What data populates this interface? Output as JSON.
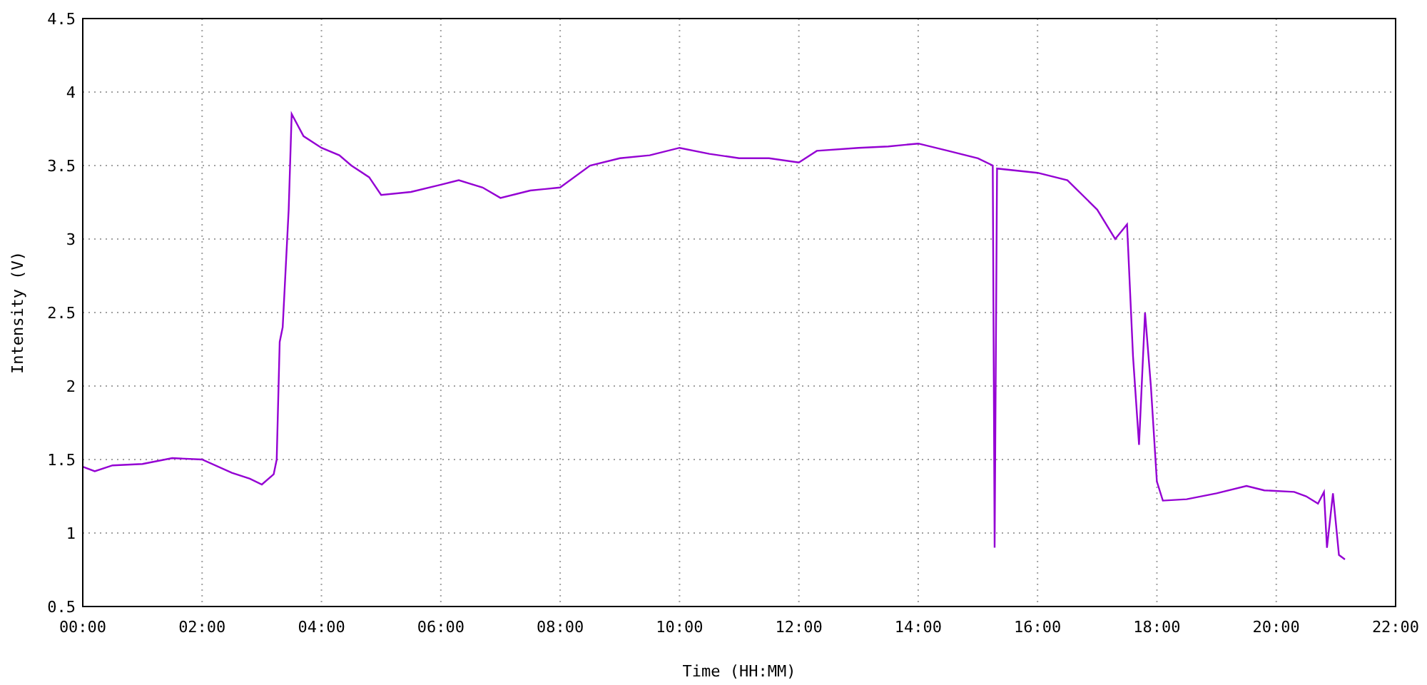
{
  "chart_data": {
    "type": "line",
    "xlabel": "Time (HH:MM)",
    "ylabel": "Intensity (V)",
    "x": [
      0,
      0.2,
      0.5,
      1.0,
      1.5,
      2.0,
      2.5,
      2.8,
      3.0,
      3.2,
      3.25,
      3.3,
      3.35,
      3.45,
      3.5,
      3.7,
      4.0,
      4.3,
      4.5,
      4.8,
      5.0,
      5.5,
      6.0,
      6.3,
      6.7,
      7.0,
      7.5,
      8.0,
      8.5,
      9.0,
      9.5,
      10.0,
      10.5,
      11.0,
      11.5,
      12.0,
      12.3,
      13.0,
      13.5,
      14.0,
      14.5,
      15.0,
      15.25,
      15.28,
      15.32,
      16.0,
      16.5,
      17.0,
      17.3,
      17.5,
      17.6,
      17.7,
      17.8,
      17.9,
      18.0,
      18.1,
      18.5,
      19.0,
      19.5,
      19.8,
      20.3,
      20.5,
      20.7,
      20.8,
      20.85,
      20.95,
      21.05,
      21.15
    ],
    "series": [
      {
        "color": "#9400d3",
        "values": [
          1.45,
          1.42,
          1.46,
          1.47,
          1.51,
          1.5,
          1.41,
          1.37,
          1.33,
          1.4,
          1.5,
          2.3,
          2.4,
          3.2,
          3.85,
          3.7,
          3.62,
          3.57,
          3.5,
          3.42,
          3.3,
          3.32,
          3.37,
          3.4,
          3.35,
          3.28,
          3.33,
          3.35,
          3.5,
          3.55,
          3.57,
          3.62,
          3.58,
          3.55,
          3.55,
          3.52,
          3.6,
          3.62,
          3.63,
          3.65,
          3.6,
          3.55,
          3.5,
          0.9,
          3.48,
          3.45,
          3.4,
          3.2,
          3.0,
          3.1,
          2.2,
          1.6,
          2.5,
          2.0,
          1.35,
          1.22,
          1.23,
          1.27,
          1.32,
          1.29,
          1.28,
          1.25,
          1.2,
          1.28,
          0.9,
          1.27,
          0.85,
          0.82
        ]
      }
    ],
    "grid": true,
    "xlim": [
      0,
      22
    ],
    "ylim": [
      0.5,
      4.5
    ],
    "xticks": [
      {
        "value": 0,
        "label": "00:00"
      },
      {
        "value": 2,
        "label": "02:00"
      },
      {
        "value": 4,
        "label": "04:00"
      },
      {
        "value": 6,
        "label": "06:00"
      },
      {
        "value": 8,
        "label": "08:00"
      },
      {
        "value": 10,
        "label": "10:00"
      },
      {
        "value": 12,
        "label": "12:00"
      },
      {
        "value": 14,
        "label": "14:00"
      },
      {
        "value": 16,
        "label": "16:00"
      },
      {
        "value": 18,
        "label": "18:00"
      },
      {
        "value": 20,
        "label": "20:00"
      },
      {
        "value": 22,
        "label": "22:00"
      }
    ],
    "yticks": [
      {
        "value": 0.5,
        "label": "0.5"
      },
      {
        "value": 1,
        "label": "1"
      },
      {
        "value": 1.5,
        "label": "1.5"
      },
      {
        "value": 2,
        "label": "2"
      },
      {
        "value": 2.5,
        "label": "2.5"
      },
      {
        "value": 3,
        "label": "3"
      },
      {
        "value": 3.5,
        "label": "3.5"
      },
      {
        "value": 4,
        "label": "4"
      },
      {
        "value": 4.5,
        "label": "4.5"
      }
    ]
  }
}
